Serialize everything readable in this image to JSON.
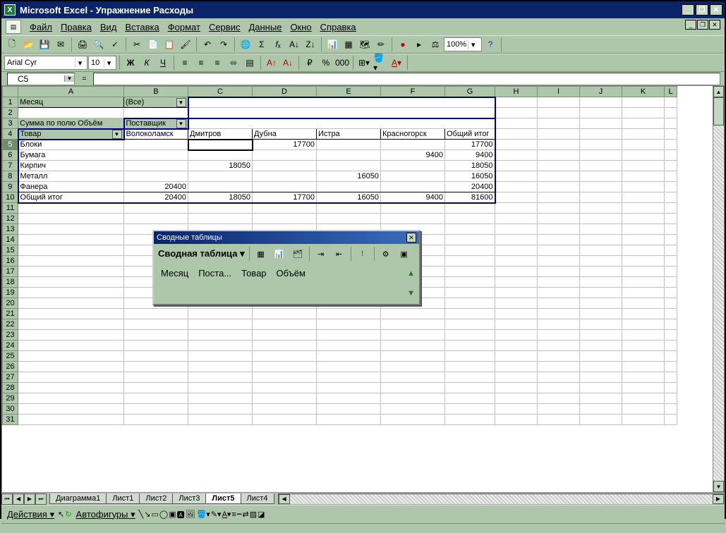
{
  "title": "Microsoft Excel - Упражнение Расходы",
  "menu": {
    "file": "Файл",
    "edit": "Правка",
    "view": "Вид",
    "insert": "Вставка",
    "format": "Формат",
    "tools": "Сервис",
    "data": "Данные",
    "window": "Окно",
    "help": "Справка"
  },
  "format_toolbar": {
    "font": "Arial Cyr",
    "size": "10",
    "zoom": "100%"
  },
  "namebox": {
    "cell": "C5",
    "fx": "="
  },
  "columns": [
    "A",
    "B",
    "C",
    "D",
    "E",
    "F",
    "G",
    "H",
    "I",
    "J",
    "K",
    "L"
  ],
  "pivot": {
    "page_field": "Месяц",
    "page_value": "(Все)",
    "data_label": "Сумма по полю Объём",
    "col_field": "Поставщик",
    "row_field": "Товар",
    "col_headers": [
      "Волоколамск",
      "Дмитров",
      "Дубна",
      "Истра",
      "Красногорск",
      "Общий итог"
    ],
    "rows": [
      {
        "label": "Блоки",
        "vals": [
          "",
          "",
          "17700",
          "",
          "",
          "17700"
        ]
      },
      {
        "label": "Бумага",
        "vals": [
          "",
          "",
          "",
          "",
          "9400",
          "9400"
        ]
      },
      {
        "label": "Кирпич",
        "vals": [
          "",
          "18050",
          "",
          "",
          "",
          "18050"
        ]
      },
      {
        "label": "Металл",
        "vals": [
          "",
          "",
          "",
          "16050",
          "",
          "16050"
        ]
      },
      {
        "label": "Фанера",
        "vals": [
          "20400",
          "",
          "",
          "",
          "",
          "20400"
        ]
      },
      {
        "label": "Общий итог",
        "vals": [
          "20400",
          "18050",
          "17700",
          "16050",
          "9400",
          "81600"
        ]
      }
    ]
  },
  "pivot_toolbar": {
    "title": "Сводные таблицы",
    "menu": "Сводная таблица",
    "fields": [
      "Месяц",
      "Поста...",
      "Товар",
      "Объём"
    ]
  },
  "sheet_tabs": [
    "Диаграмма1",
    "Лист1",
    "Лист2",
    "Лист3",
    "Лист5",
    "Лист4"
  ],
  "active_tab": "Лист5",
  "bottom_bar": {
    "actions": "Действия",
    "autoshapes": "Автофигуры"
  }
}
